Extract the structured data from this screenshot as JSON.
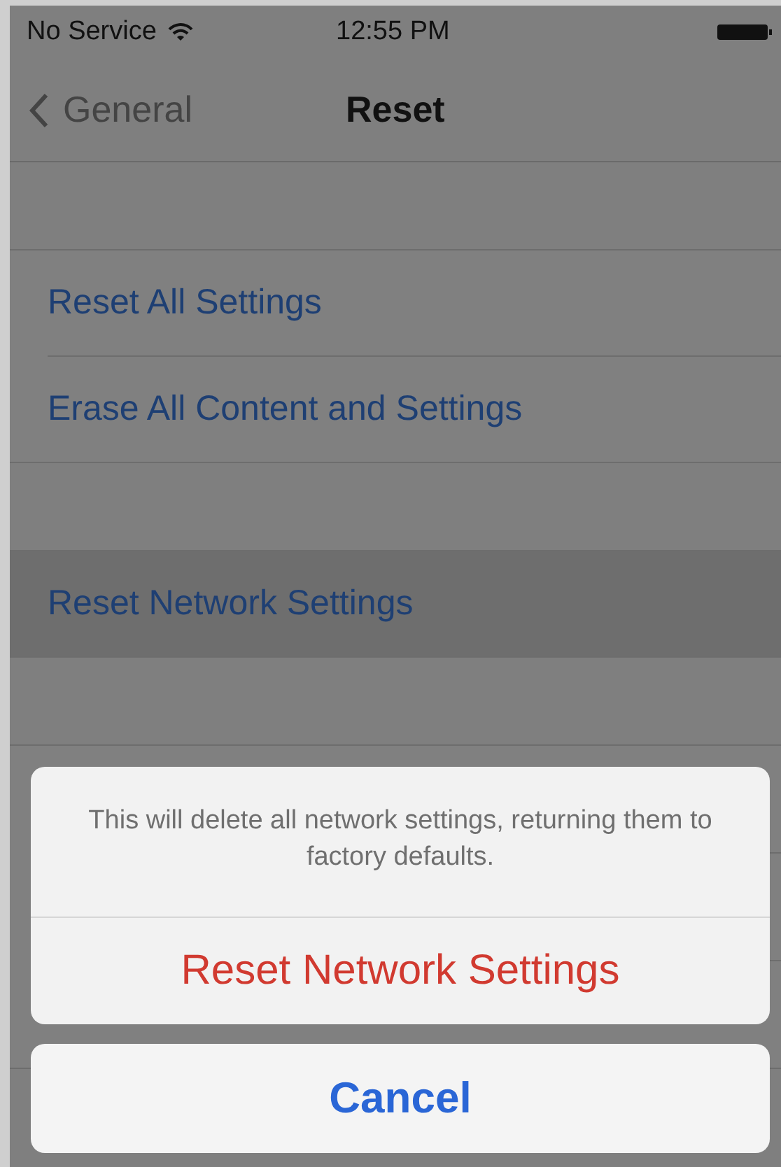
{
  "status_bar": {
    "carrier": "No Service",
    "time": "12:55 PM"
  },
  "nav": {
    "back": "General",
    "title": "Reset"
  },
  "groups": [
    [
      {
        "label": "Reset All Settings",
        "selected": false
      },
      {
        "label": "Erase All Content and Settings",
        "selected": false
      }
    ],
    [
      {
        "label": "Reset Network Settings",
        "selected": true
      }
    ]
  ],
  "action_sheet": {
    "message": "This will delete all network settings, returning them to factory defaults.",
    "destructive": "Reset Network Settings",
    "cancel": "Cancel"
  }
}
